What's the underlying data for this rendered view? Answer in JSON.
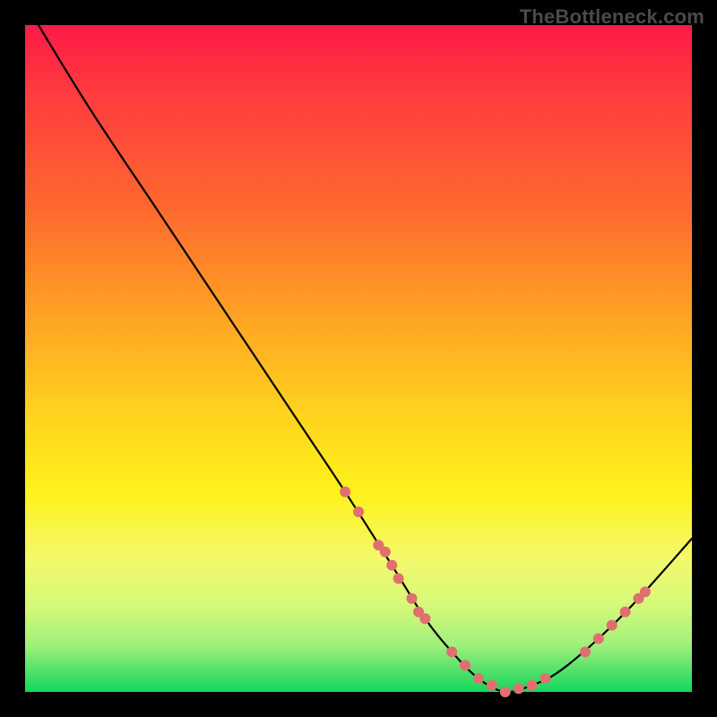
{
  "watermark": "TheBottleneck.com",
  "chart_data": {
    "type": "line",
    "title": "",
    "xlabel": "",
    "ylabel": "",
    "xlim": [
      0,
      100
    ],
    "ylim": [
      0,
      100
    ],
    "background_gradient": {
      "top_color": "#ff1a47",
      "bottom_color": "#12d85b",
      "meaning": "red = high bottleneck, green = low bottleneck"
    },
    "series": [
      {
        "name": "bottleneck-curve",
        "x": [
          2,
          10,
          20,
          30,
          40,
          48,
          55,
          60,
          64,
          68,
          72,
          76,
          80,
          86,
          92,
          100
        ],
        "values": [
          100,
          87,
          72,
          57,
          42,
          30,
          19,
          11,
          6,
          2,
          0,
          1,
          3,
          8,
          14,
          23
        ]
      }
    ],
    "markers": {
      "name": "highlighted-points",
      "color": "#e07070",
      "points_xy": [
        [
          48,
          30
        ],
        [
          50,
          27
        ],
        [
          53,
          22
        ],
        [
          54,
          21
        ],
        [
          55,
          19
        ],
        [
          56,
          17
        ],
        [
          58,
          14
        ],
        [
          59,
          12
        ],
        [
          60,
          11
        ],
        [
          64,
          6
        ],
        [
          66,
          4
        ],
        [
          68,
          2
        ],
        [
          70,
          1
        ],
        [
          72,
          0
        ],
        [
          74,
          0.5
        ],
        [
          76,
          1
        ],
        [
          78,
          2
        ],
        [
          84,
          6
        ],
        [
          86,
          8
        ],
        [
          88,
          10
        ],
        [
          90,
          12
        ],
        [
          92,
          14
        ],
        [
          93,
          15
        ]
      ]
    }
  }
}
